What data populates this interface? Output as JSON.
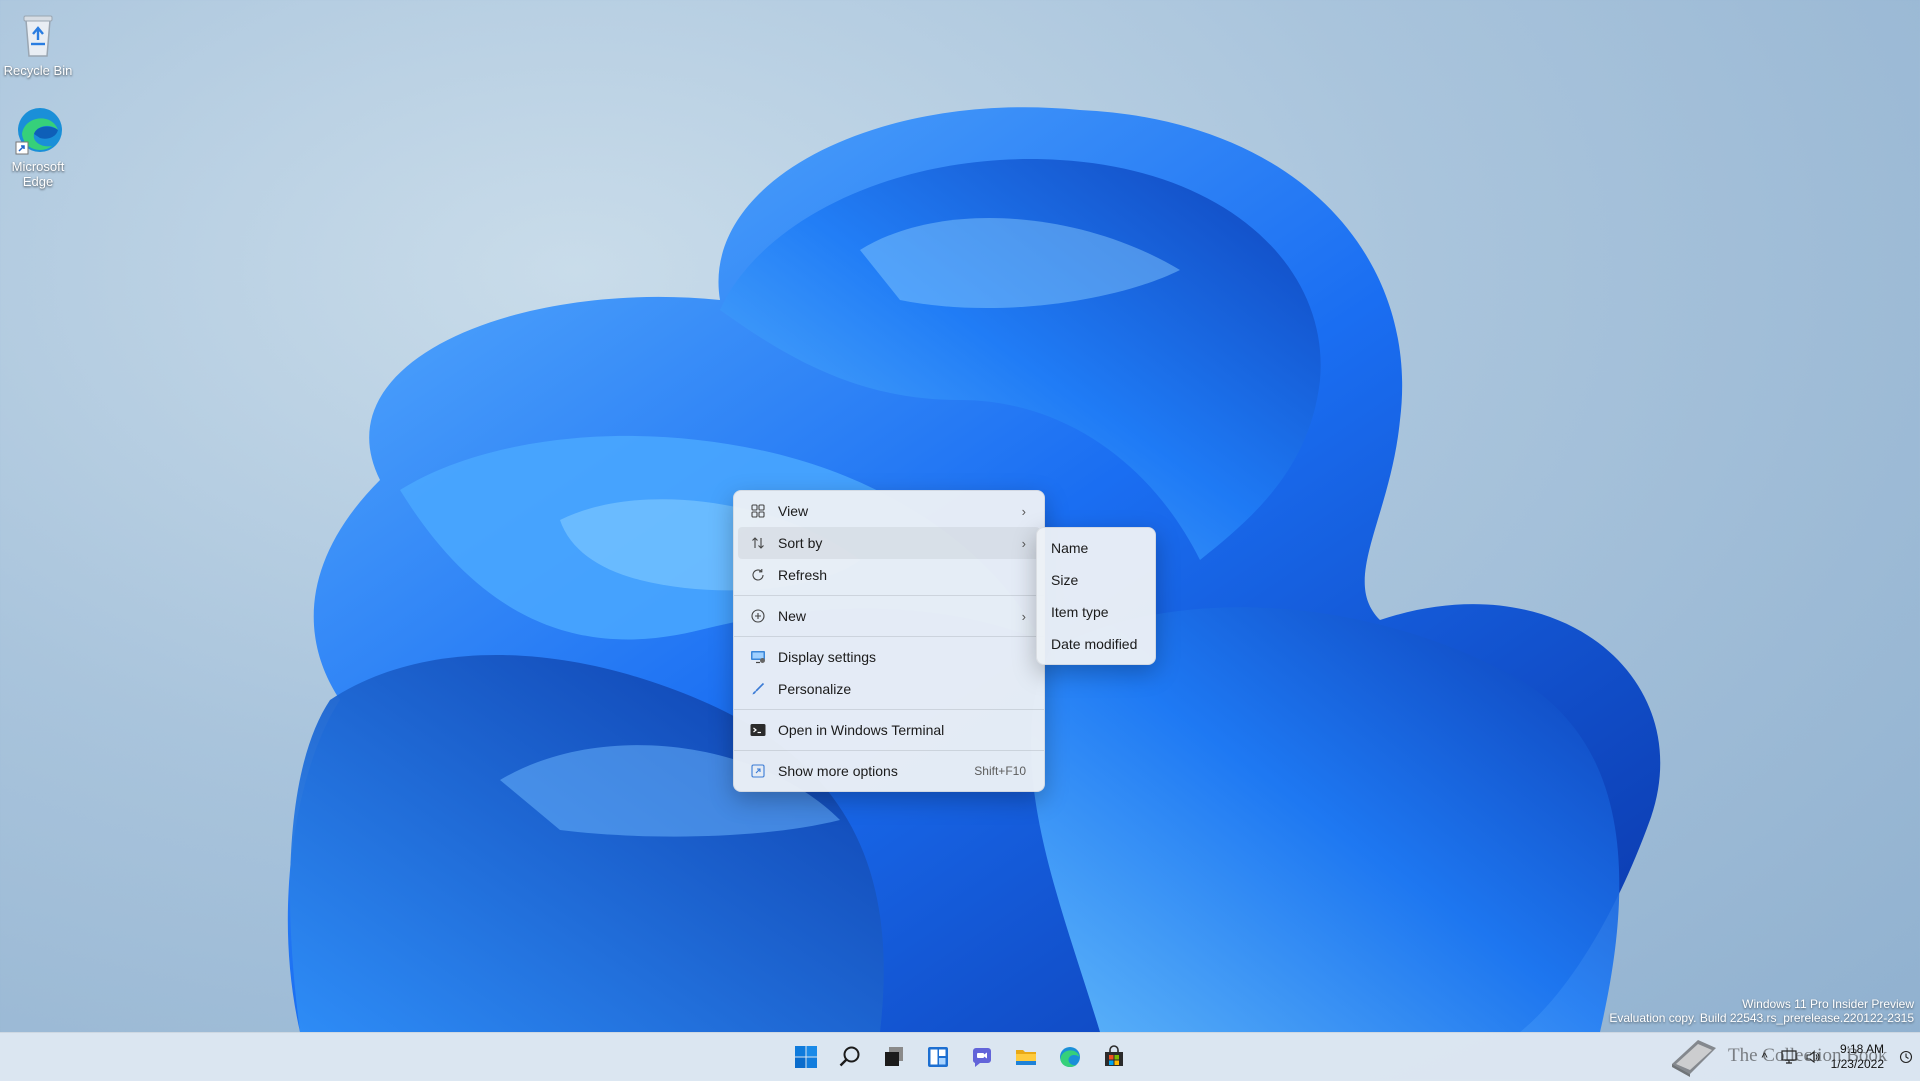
{
  "desktop": {
    "icons": [
      {
        "label": "Recycle Bin",
        "icon": "recycle-bin-icon"
      },
      {
        "label": "Microsoft Edge",
        "icon": "edge-icon"
      }
    ]
  },
  "context_menu": {
    "items": [
      {
        "label": "View",
        "icon": "grid-view-icon",
        "has_submenu": true
      },
      {
        "label": "Sort by",
        "icon": "sort-icon",
        "has_submenu": true,
        "active": true
      },
      {
        "label": "Refresh",
        "icon": "refresh-icon"
      },
      {
        "label": "New",
        "icon": "add-circle-icon",
        "has_submenu": true
      },
      {
        "label": "Display settings",
        "icon": "display-settings-icon"
      },
      {
        "label": "Personalize",
        "icon": "brush-icon"
      },
      {
        "label": "Open in Windows Terminal",
        "icon": "terminal-icon"
      },
      {
        "label": "Show more options",
        "icon": "more-options-icon",
        "shortcut": "Shift+F10"
      }
    ],
    "submenu": {
      "parent": "Sort by",
      "items": [
        "Name",
        "Size",
        "Item type",
        "Date modified"
      ]
    }
  },
  "watermark": {
    "line1": "Windows 11 Pro Insider Preview",
    "line2": "Evaluation copy. Build 22543.rs_prerelease.220122-2315"
  },
  "taskbar": {
    "pinned": [
      {
        "name": "start-button",
        "icon": "windows-logo-icon"
      },
      {
        "name": "search-button",
        "icon": "search-icon"
      },
      {
        "name": "task-view-button",
        "icon": "task-view-icon"
      },
      {
        "name": "widgets-button",
        "icon": "widgets-icon"
      },
      {
        "name": "chat-button",
        "icon": "chat-icon"
      },
      {
        "name": "file-explorer-button",
        "icon": "folder-icon"
      },
      {
        "name": "edge-button",
        "icon": "edge-icon"
      },
      {
        "name": "store-button",
        "icon": "store-icon"
      }
    ],
    "tray": {
      "overflow": "^",
      "time": "9:18 AM",
      "date": "1/23/2022"
    },
    "brand_text": "The Collection Book"
  },
  "colors": {
    "accent": "#0067c0",
    "bloom_dark": "#0a3fb0",
    "bloom_light": "#3a9bf5",
    "menu_bg": "#ecf0f6"
  }
}
